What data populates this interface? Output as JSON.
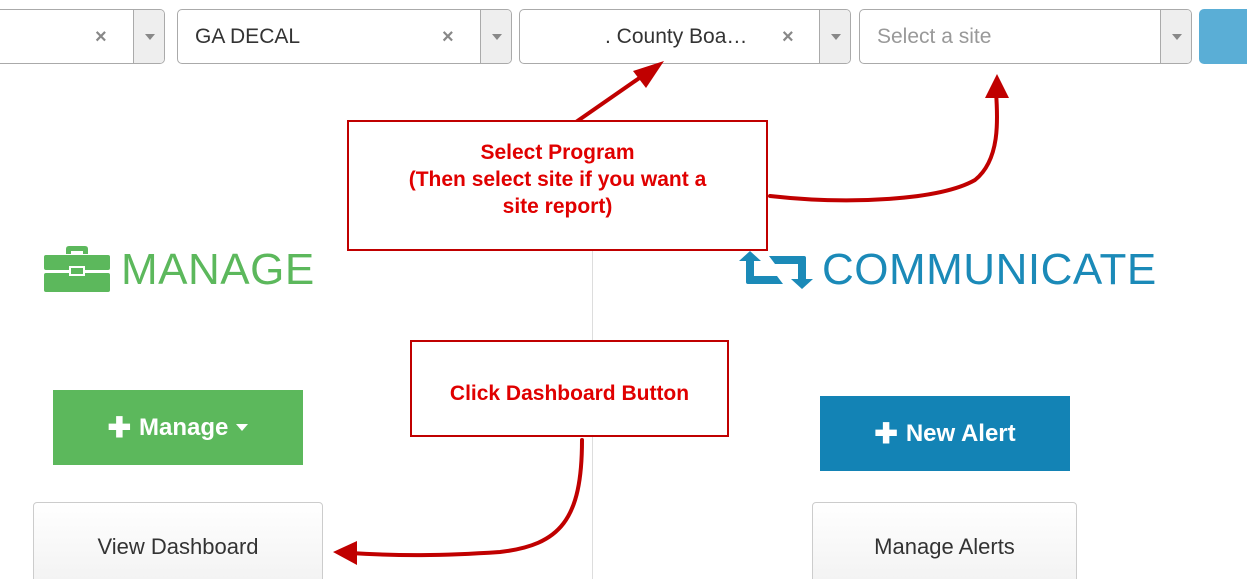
{
  "filters": {
    "select1": {
      "value": "",
      "clear_glyph": "×"
    },
    "program_group": {
      "value": "GA DECAL",
      "clear_glyph": "×"
    },
    "program": {
      "value": ".        County Boa…",
      "clear_glyph": "×"
    },
    "site": {
      "placeholder": "Select a site"
    }
  },
  "annotations": {
    "select_program_line1": "Select Program",
    "select_program_line2": "(Then select site if you want a",
    "select_program_line3": "site report)",
    "click_dashboard": "Click Dashboard Button"
  },
  "manage": {
    "title": "MANAGE",
    "icon": "briefcase-icon",
    "button_label": "Manage",
    "dashboard_label": "View Dashboard"
  },
  "communicate": {
    "title": "COMMUNICATE",
    "icon": "retweet-arrows-icon",
    "button_label": "New Alert",
    "manage_alerts_label": "Manage Alerts"
  },
  "colors": {
    "manage_green": "#5cb85c",
    "communicate_blue": "#1383b5",
    "annotation_red": "#e00000",
    "arrow_red": "#c00000"
  }
}
